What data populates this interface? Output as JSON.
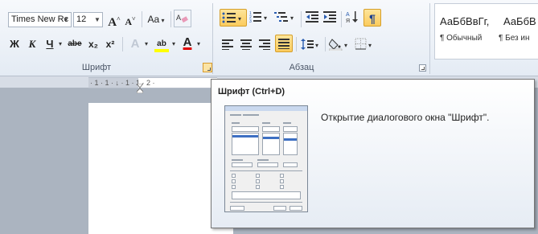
{
  "font_group": {
    "font_name": "Times New Rc",
    "font_size": "12",
    "grow_font": "A",
    "shrink_font": "A",
    "change_case": "Aa",
    "bold": "Ж",
    "italic": "К",
    "underline": "Ч",
    "strikethrough": "abe",
    "subscript": "x₂",
    "superscript": "x²",
    "text_effects": "A",
    "highlight": "ab",
    "font_color": "A",
    "label": "Шрифт"
  },
  "paragraph_group": {
    "label": "Абзац"
  },
  "styles_group": {
    "items": [
      {
        "sample": "АаБбВвГг,",
        "name": "¶ Обычный"
      },
      {
        "sample": "АаБбВ",
        "name": "¶ Без ин"
      }
    ]
  },
  "ruler": {
    "text": "· 1 · 1 · ↓ · 1 · 1 · 2 ·"
  },
  "tooltip": {
    "title": "Шрифт (Ctrl+D)",
    "description": "Открытие диалогового окна \"Шрифт\"."
  },
  "colors": {
    "highlight": "#ffff00",
    "font_color": "#e00000",
    "active": "#fbcb5d"
  }
}
